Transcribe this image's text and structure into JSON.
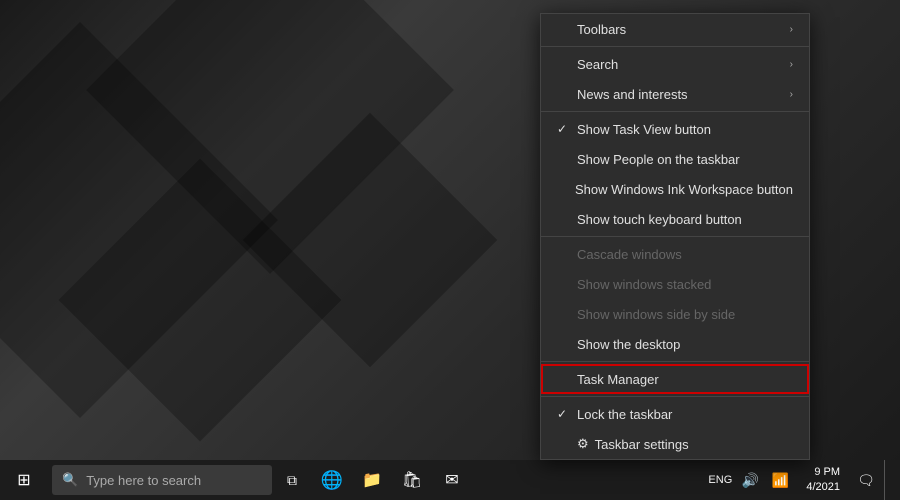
{
  "desktop": {
    "background_color": "#2a2a2a"
  },
  "taskbar": {
    "start_label": "⊞",
    "search_placeholder": "Type here to search",
    "clock": {
      "time": "9 PM",
      "date": "4/2021"
    },
    "icons": [
      "⧉",
      "🌐",
      "📁",
      "📌",
      "✉"
    ]
  },
  "context_menu": {
    "items": [
      {
        "id": "toolbars",
        "label": "Toolbars",
        "has_arrow": true,
        "disabled": false,
        "checked": false,
        "has_check": false,
        "separator_after": true
      },
      {
        "id": "search",
        "label": "Search",
        "has_arrow": true,
        "disabled": false,
        "checked": false,
        "has_check": false,
        "separator_after": false
      },
      {
        "id": "news-interests",
        "label": "News and interests",
        "has_arrow": true,
        "disabled": false,
        "checked": false,
        "has_check": false,
        "separator_after": true
      },
      {
        "id": "show-task-view",
        "label": "Show Task View button",
        "has_arrow": false,
        "disabled": false,
        "checked": true,
        "has_check": true,
        "separator_after": false
      },
      {
        "id": "show-people",
        "label": "Show People on the taskbar",
        "has_arrow": false,
        "disabled": false,
        "checked": false,
        "has_check": false,
        "separator_after": false
      },
      {
        "id": "show-ink",
        "label": "Show Windows Ink Workspace button",
        "has_arrow": false,
        "disabled": false,
        "checked": false,
        "has_check": false,
        "separator_after": false
      },
      {
        "id": "show-touch-keyboard",
        "label": "Show touch keyboard button",
        "has_arrow": false,
        "disabled": false,
        "checked": false,
        "has_check": false,
        "separator_after": true
      },
      {
        "id": "cascade",
        "label": "Cascade windows",
        "has_arrow": false,
        "disabled": true,
        "checked": false,
        "has_check": false,
        "separator_after": false
      },
      {
        "id": "stacked",
        "label": "Show windows stacked",
        "has_arrow": false,
        "disabled": true,
        "checked": false,
        "has_check": false,
        "separator_after": false
      },
      {
        "id": "side-by-side",
        "label": "Show windows side by side",
        "has_arrow": false,
        "disabled": true,
        "checked": false,
        "has_check": false,
        "separator_after": false
      },
      {
        "id": "show-desktop",
        "label": "Show the desktop",
        "has_arrow": false,
        "disabled": false,
        "checked": false,
        "has_check": false,
        "separator_after": true
      },
      {
        "id": "task-manager",
        "label": "Task Manager",
        "has_arrow": false,
        "disabled": false,
        "checked": false,
        "has_check": false,
        "highlighted": true,
        "separator_after": true
      },
      {
        "id": "lock-taskbar",
        "label": "Lock the taskbar",
        "has_arrow": false,
        "disabled": false,
        "checked": true,
        "has_check": true,
        "separator_after": false
      },
      {
        "id": "taskbar-settings",
        "label": "Taskbar settings",
        "has_arrow": false,
        "disabled": false,
        "checked": false,
        "has_check": false,
        "has_gear": true,
        "separator_after": false
      }
    ]
  }
}
